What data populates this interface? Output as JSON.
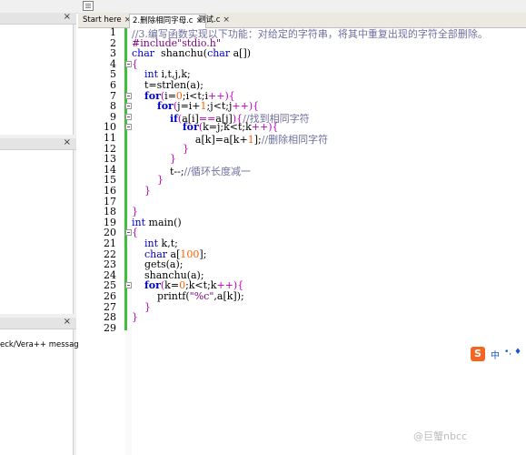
{
  "left_panel": {
    "message_tab_label": "eck/Vera++ message"
  },
  "tabs": [
    {
      "label": "Start here",
      "active": false
    },
    {
      "label": "2.删除相同字母.c",
      "active": true
    },
    {
      "label": "测试.c",
      "active": false
    }
  ],
  "close_glyph": "×",
  "editor": {
    "lines": [
      {
        "n": "1",
        "parts": [
          [
            "cm",
            "//3.编写函数实现以下功能：对给定的字符串，将其中重复出现的字符全部删除。"
          ]
        ]
      },
      {
        "n": "2",
        "parts": [
          [
            "pp",
            "#include\"stdio.h\""
          ]
        ]
      },
      {
        "n": "3",
        "parts": [
          [
            "ty",
            "char"
          ],
          [
            "",
            "  shanchu("
          ],
          [
            "ty",
            "char"
          ],
          [
            "",
            " a[])"
          ]
        ]
      },
      {
        "n": "4",
        "parts": [
          [
            "op",
            "{"
          ]
        ]
      },
      {
        "n": "5",
        "parts": [
          [
            "",
            "    "
          ],
          [
            "ty",
            "int"
          ],
          [
            "",
            " i,t,j,k;"
          ]
        ]
      },
      {
        "n": "6",
        "parts": [
          [
            "",
            "    t=strlen(a);"
          ]
        ]
      },
      {
        "n": "7",
        "parts": [
          [
            "",
            "    "
          ],
          [
            "kw",
            "for"
          ],
          [
            "op",
            "("
          ],
          [
            "",
            "i="
          ],
          [
            "nm",
            "0"
          ],
          [
            "",
            ";i<t;i"
          ],
          [
            "op",
            "++)"
          ],
          [
            "op",
            "{"
          ]
        ]
      },
      {
        "n": "8",
        "parts": [
          [
            "",
            "        "
          ],
          [
            "kw",
            "for"
          ],
          [
            "op",
            "("
          ],
          [
            "",
            "j=i+"
          ],
          [
            "nm",
            "1"
          ],
          [
            "",
            ";j<t;j"
          ],
          [
            "op",
            "++)"
          ],
          [
            "op",
            "{"
          ]
        ]
      },
      {
        "n": "9",
        "parts": [
          [
            "",
            "            "
          ],
          [
            "kw",
            "if"
          ],
          [
            "op",
            "("
          ],
          [
            "",
            "a[i]"
          ],
          [
            "op",
            "=="
          ],
          [
            "",
            "a[j]"
          ],
          [
            "op",
            ")"
          ],
          [
            "op",
            "{"
          ],
          [
            "cm",
            "//找到相同字符"
          ]
        ]
      },
      {
        "n": "10",
        "parts": [
          [
            "",
            "                "
          ],
          [
            "kw",
            "for"
          ],
          [
            "op",
            "("
          ],
          [
            "",
            "k=j;k<t;k"
          ],
          [
            "op",
            "++)"
          ],
          [
            "op",
            "{"
          ]
        ]
      },
      {
        "n": "11",
        "parts": [
          [
            "",
            "                    a[k]=a[k+"
          ],
          [
            "nm",
            "1"
          ],
          [
            "",
            "];"
          ],
          [
            "cm",
            "//删除相同字符"
          ]
        ]
      },
      {
        "n": "12",
        "parts": [
          [
            "",
            "                "
          ],
          [
            "op",
            "}"
          ]
        ]
      },
      {
        "n": "13",
        "parts": [
          [
            "",
            "            "
          ],
          [
            "op",
            "}"
          ]
        ]
      },
      {
        "n": "14",
        "parts": [
          [
            "",
            "            t--;"
          ],
          [
            "cm",
            "//循环长度减一"
          ]
        ]
      },
      {
        "n": "15",
        "parts": [
          [
            "",
            "        "
          ],
          [
            "op",
            "}"
          ]
        ]
      },
      {
        "n": "16",
        "parts": [
          [
            "",
            "    "
          ],
          [
            "op",
            "}"
          ]
        ]
      },
      {
        "n": "17",
        "parts": []
      },
      {
        "n": "18",
        "parts": [
          [
            "op",
            "}"
          ]
        ]
      },
      {
        "n": "19",
        "parts": [
          [
            "ty",
            "int"
          ],
          [
            "",
            " main()"
          ]
        ]
      },
      {
        "n": "20",
        "parts": [
          [
            "op",
            "{"
          ]
        ]
      },
      {
        "n": "21",
        "parts": [
          [
            "",
            "    "
          ],
          [
            "ty",
            "int"
          ],
          [
            "",
            " k,t;"
          ]
        ]
      },
      {
        "n": "22",
        "parts": [
          [
            "",
            "    "
          ],
          [
            "ty",
            "char"
          ],
          [
            "",
            " a["
          ],
          [
            "nm",
            "100"
          ],
          [
            "",
            "];"
          ]
        ]
      },
      {
        "n": "23",
        "parts": [
          [
            "",
            "    gets(a);"
          ]
        ]
      },
      {
        "n": "24",
        "parts": [
          [
            "",
            "    shanchu(a);"
          ]
        ]
      },
      {
        "n": "25",
        "parts": [
          [
            "",
            "    "
          ],
          [
            "kw",
            "for"
          ],
          [
            "op",
            "("
          ],
          [
            "",
            "k="
          ],
          [
            "nm",
            "0"
          ],
          [
            "",
            ";k<t;k"
          ],
          [
            "op",
            "++)"
          ],
          [
            "op",
            "{"
          ]
        ]
      },
      {
        "n": "26",
        "parts": [
          [
            "",
            "        printf("
          ],
          [
            "st",
            "\"%c\""
          ],
          [
            "",
            ",a[k]);"
          ]
        ]
      },
      {
        "n": "27",
        "parts": [
          [
            "",
            "    "
          ],
          [
            "op",
            "}"
          ]
        ]
      },
      {
        "n": "28",
        "parts": [
          [
            "op",
            "}"
          ]
        ]
      },
      {
        "n": "29",
        "parts": []
      }
    ]
  },
  "ime": {
    "logo": "S",
    "label": "中",
    "extra": "•, ♦"
  },
  "watermark": "@巨蟹nbcc"
}
